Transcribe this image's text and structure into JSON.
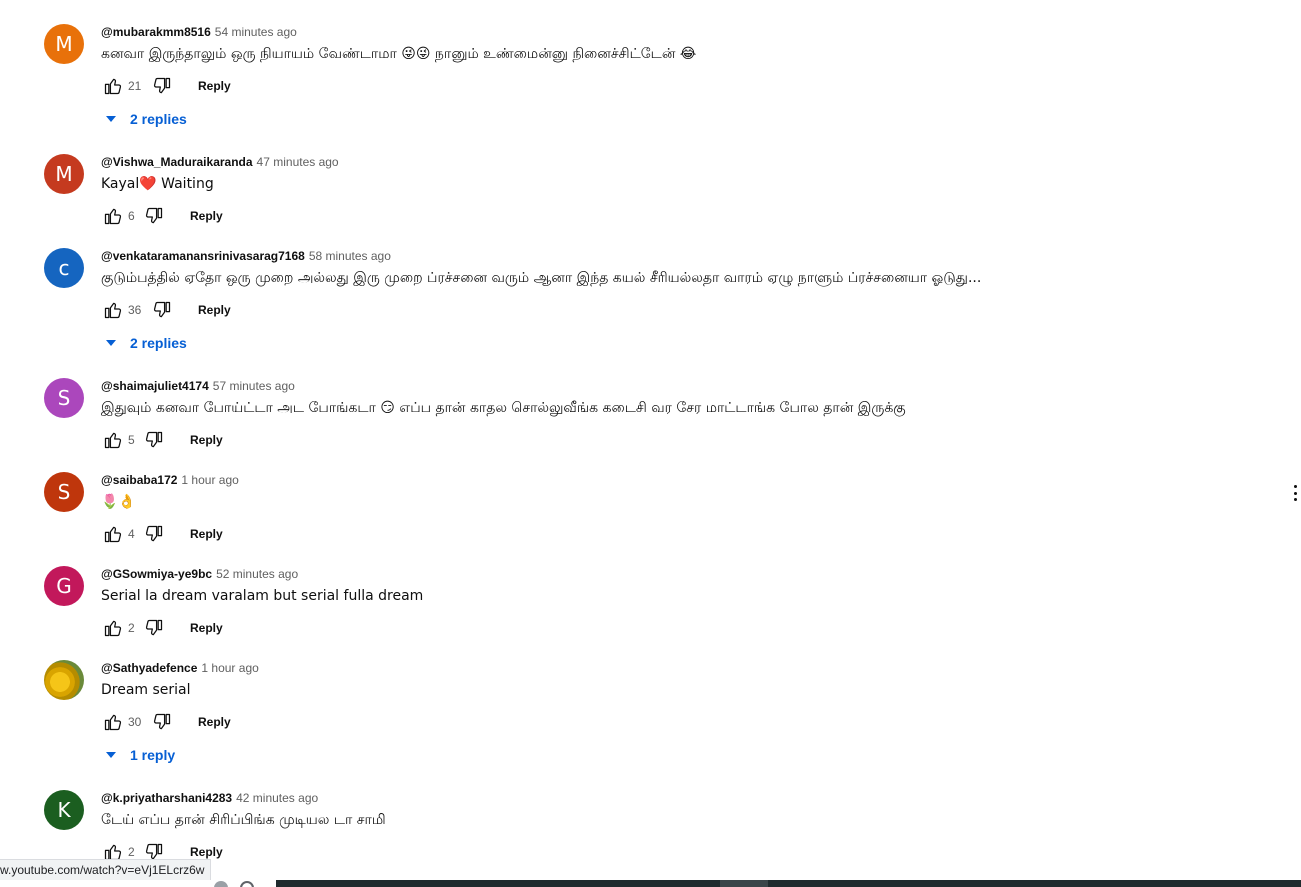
{
  "colors": {
    "link_blue": "#065fd4",
    "muted_text": "#606060"
  },
  "icons": {
    "like": "thumb-up-icon",
    "dislike": "thumb-down-icon",
    "toggle": "caret-down-icon",
    "more": "more-vert-icon"
  },
  "reply_label": "Reply",
  "comments": [
    {
      "avatar_letter": "M",
      "avatar_color": "#e8710a",
      "author": "@mubarakmm8516",
      "time": "54 minutes ago",
      "text": "கனவா இருந்தாலும் ஒரு நியாயம் வேண்டாமா 😜😜 நானும் உண்மைன்னு நினைச்சிட்டேன் 😂",
      "likes": "21",
      "replies": "2 replies"
    },
    {
      "avatar_letter": "M",
      "avatar_color": "#c53a1f",
      "author": "@Vishwa_Maduraikaranda",
      "time": "47 minutes ago",
      "text": "Kayal❤️ Waiting",
      "likes": "6",
      "replies": ""
    },
    {
      "avatar_letter": "c",
      "avatar_color": "#1565c0",
      "author": "@venkataramanansrinivasarag7168",
      "time": "58 minutes ago",
      "text": "குடும்பத்தில் ஏதோ ஒரு முறை அல்லது இரு முறை ப்ரச்சனை வரும் ஆனா இந்த கயல் சீரியல்லதா வாரம் ஏழு நாளும் ப்ரச்சனையா ஓடுது...",
      "likes": "36",
      "replies": "2 replies"
    },
    {
      "avatar_letter": "S",
      "avatar_color": "#ab47bc",
      "author": "@shaimajuliet4174",
      "time": "57 minutes ago",
      "text": "இதுவும் கனவா போய்ட்டா அட போங்கடா 😏 எப்ப  தான் காதல சொல்லுவீங்க  கடைசி வர சேர மாட்டாங்க போல தான் இருக்கு",
      "likes": "5",
      "replies": ""
    },
    {
      "avatar_letter": "S",
      "avatar_color": "#bf360c",
      "author": "@saibaba172",
      "time": "1 hour ago",
      "text": "🌷👌",
      "likes": "4",
      "replies": ""
    },
    {
      "avatar_letter": "G",
      "avatar_color": "#c2185b",
      "author": "@GSowmiya-ye9bc",
      "time": "52 minutes ago",
      "text": "Serial la dream varalam but serial fulla dream",
      "likes": "2",
      "replies": ""
    },
    {
      "avatar_letter": "",
      "avatar_color": "#d9a400",
      "author": "@Sathyadefence",
      "time": "1 hour ago",
      "text": "Dream serial",
      "likes": "30",
      "replies": "1 reply"
    },
    {
      "avatar_letter": "K",
      "avatar_color": "#1b5e20",
      "author": "@k.priyatharshani4283",
      "time": "42 minutes ago",
      "text": "டேய் எப்ப தான் சிரிப்பிங்க  முடியல டா சாமி",
      "likes": "2",
      "replies": ""
    }
  ],
  "status_bar_url": "w.youtube.com/watch?v=eVj1ELcrz6w"
}
